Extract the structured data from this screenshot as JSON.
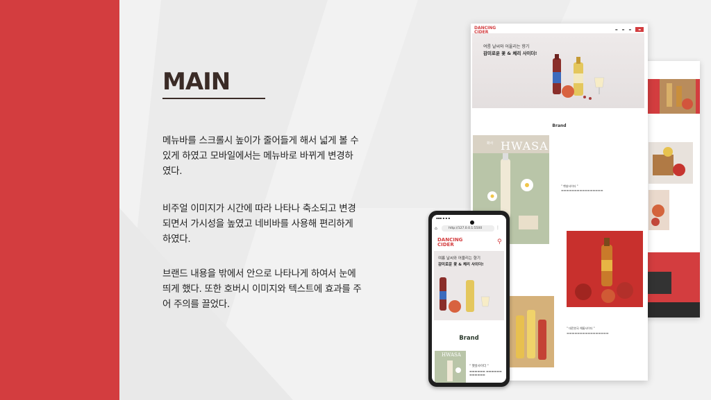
{
  "slide": {
    "title": "MAIN",
    "paragraphs": [
      [
        "메뉴바를 스크롤시 높이가 줄어들게 해서 넓게 볼 수",
        "있게 하였고 모바일에서는 메뉴바로 바뀌게 변경하",
        "였다."
      ],
      [
        "비주얼 이미지가 시간에 따라 나타나 축소되고 변경",
        "되면서 가시성을 높였고 네비바를 사용해 편리하게",
        "하였다."
      ],
      [
        "브랜드 내용을 밖에서 안으로 나타나게 하여서 눈에",
        "띄게 했다. 또한 호버시 이미지와 텍스트에 효과를 주",
        "어 주의를 끌었다."
      ]
    ],
    "colors": {
      "accent_red": "#d33d3f",
      "title": "#3a2b26"
    }
  },
  "desktop": {
    "logo": [
      "DANCING",
      "CIDER"
    ],
    "hero_line1": "여름 날씨와 어울리는 향기",
    "hero_line2": "감미로운 꽃 & 체리 사이더!",
    "brand_heading": "Brand",
    "hwasa_label": "HWASA",
    "hwasa_korean": "화사",
    "card1_caption": "\" 햇살사이더 \"",
    "card2_caption": "\" 대전한국 해룸사이더 \""
  },
  "phone": {
    "url": "http://127.0.0.1:5500",
    "logo": [
      "DANCING",
      "CIDER"
    ],
    "hero_line1": "여름 날씨와 어울리는 향기",
    "hero_line2": "감미로운 꽃 & 체리 사이더!",
    "brand_heading": "Brand",
    "hwasa_label": "HWASA",
    "card_caption": "\" 햇살사이더 \""
  }
}
